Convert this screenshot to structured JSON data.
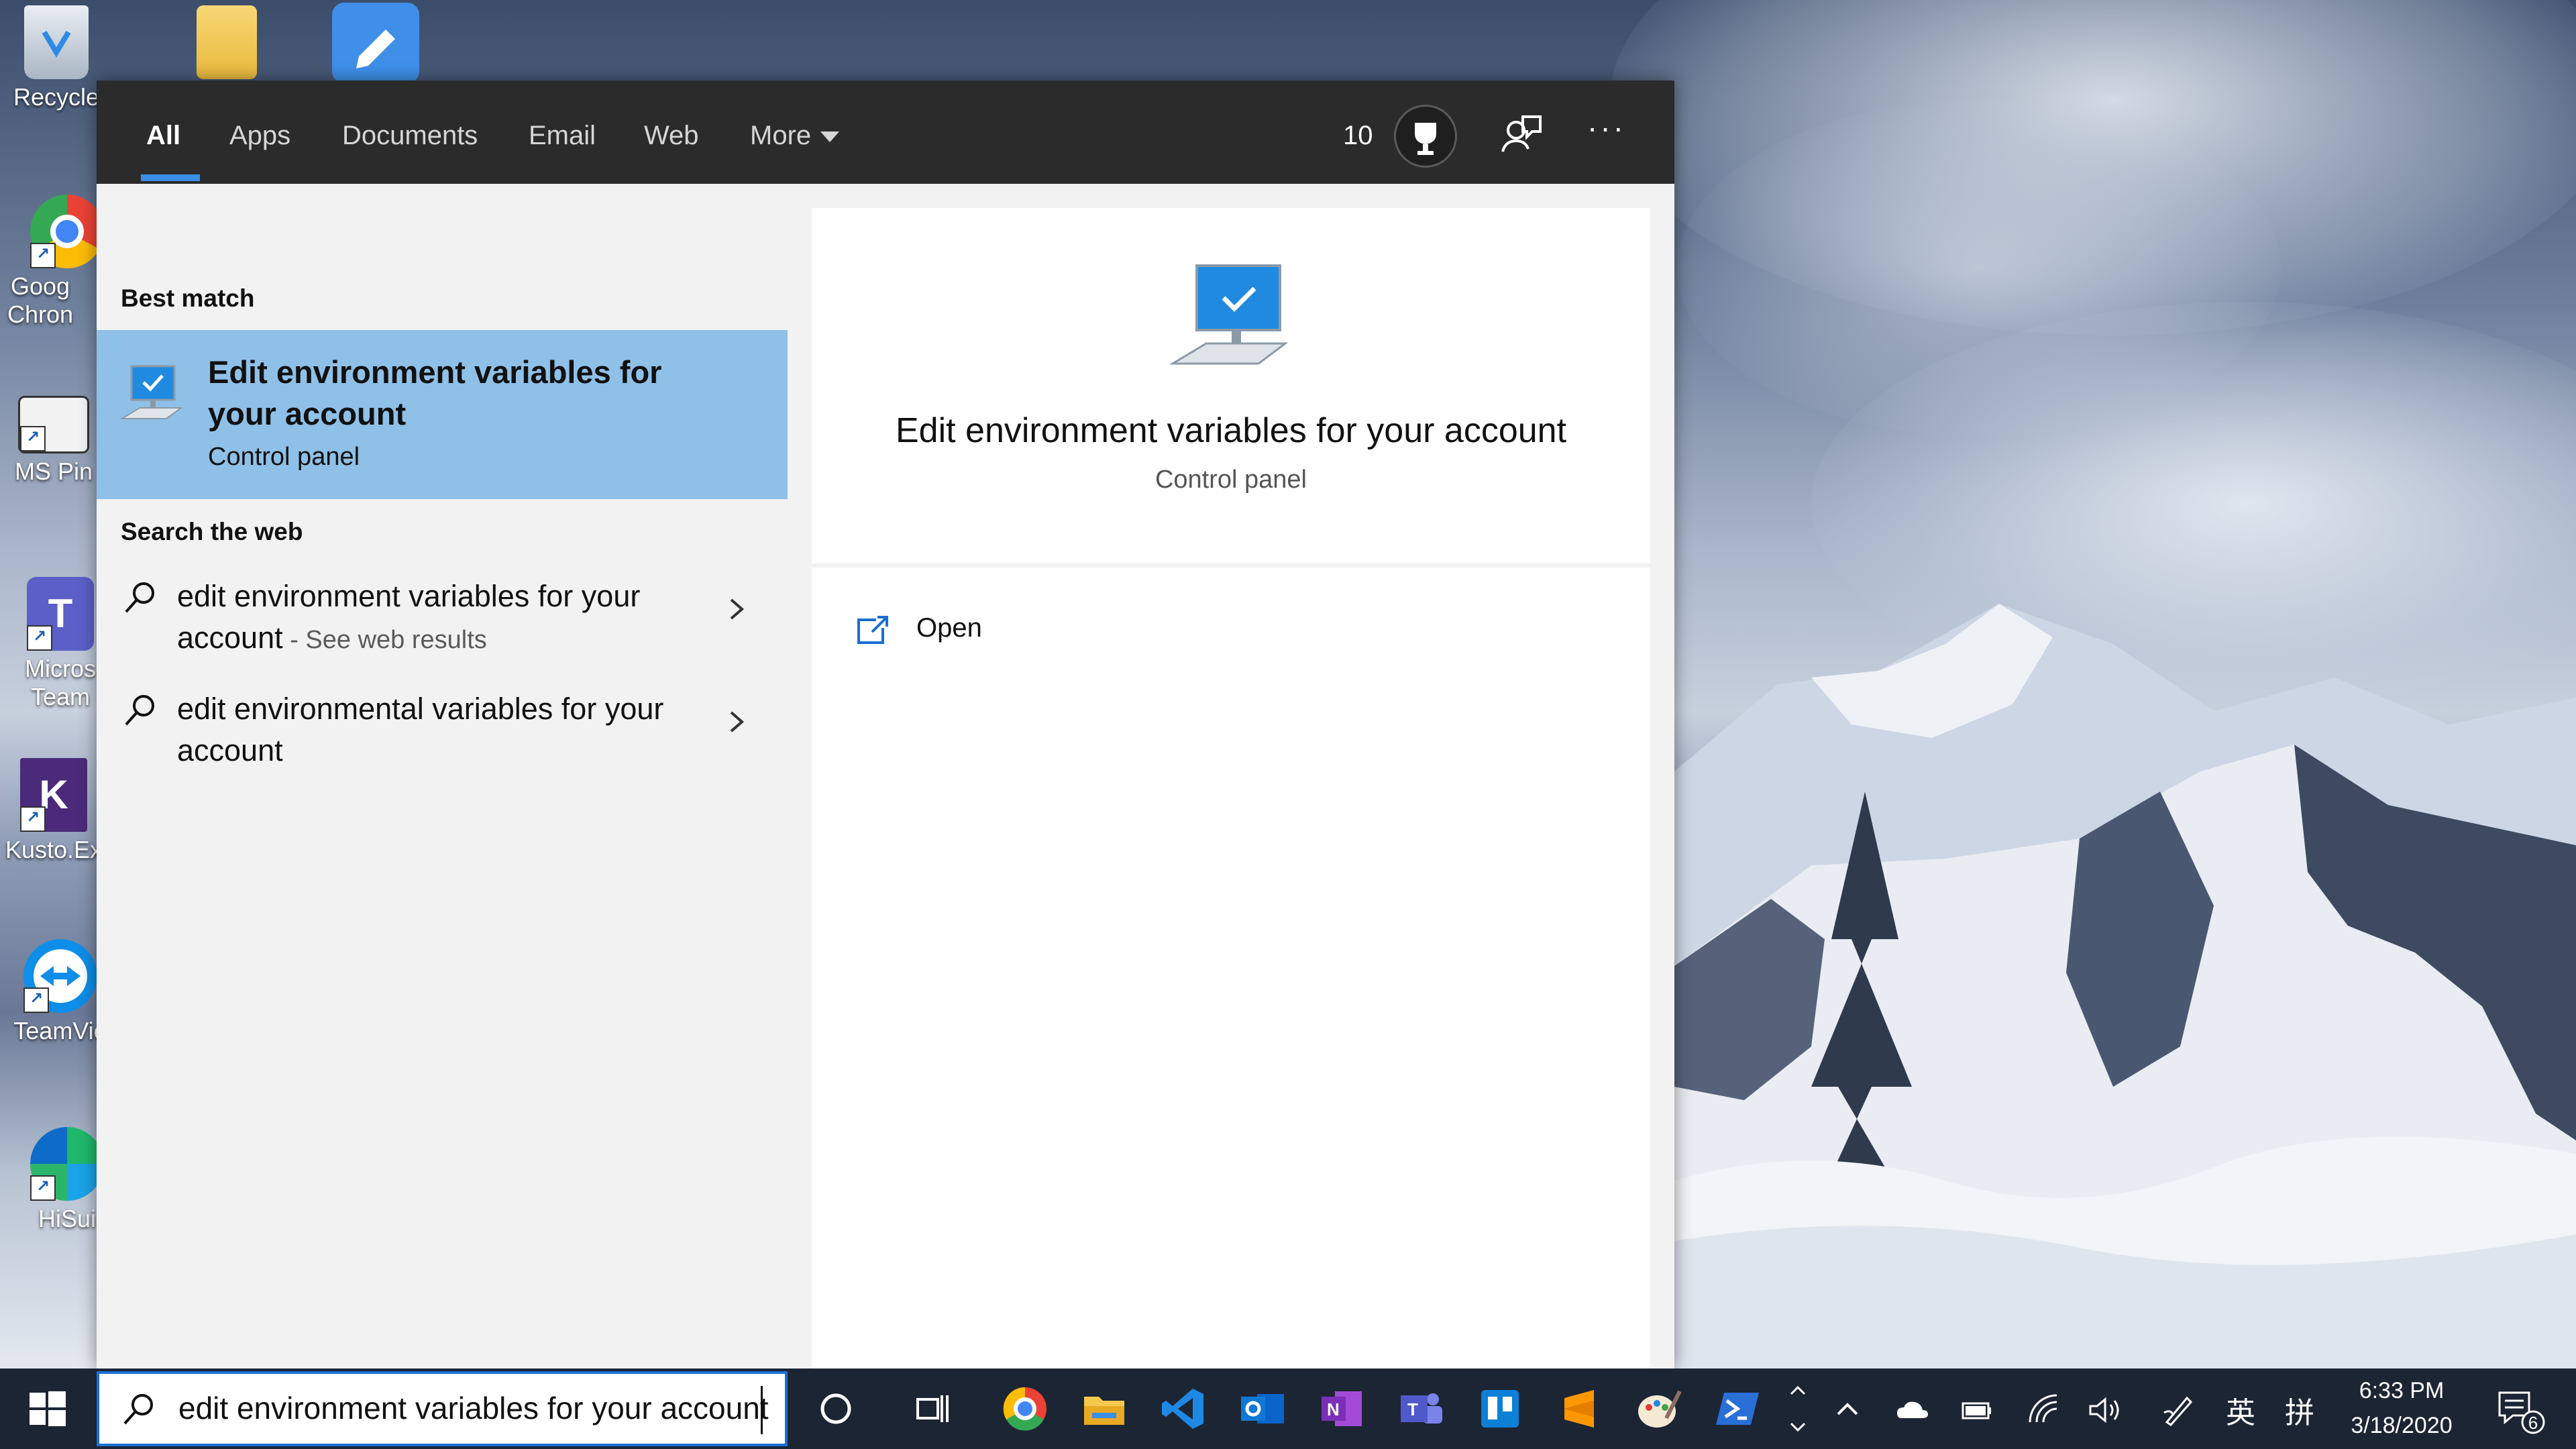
{
  "desktop": {
    "icons": [
      {
        "label": "Recycle"
      },
      {
        "label": ""
      },
      {
        "label": ""
      },
      {
        "label": "Goog\nChron"
      },
      {
        "label": "MS Pin"
      },
      {
        "label": "Micros\nTeam"
      },
      {
        "label": "Kusto.Ex"
      },
      {
        "label": "TeamVie"
      },
      {
        "label": "HiSui"
      }
    ]
  },
  "search_panel": {
    "tabs": [
      {
        "label": "All",
        "active": true
      },
      {
        "label": "Apps"
      },
      {
        "label": "Documents"
      },
      {
        "label": "Email"
      },
      {
        "label": "Web"
      },
      {
        "label": "More"
      }
    ],
    "points": "10",
    "more_menu": "···",
    "best_match": {
      "section_label": "Best match",
      "title": "Edit environment variables for your account",
      "subtitle": "Control panel"
    },
    "search_web": {
      "section_label": "Search the web",
      "items": [
        {
          "text": "edit environment variables for your account",
          "hint": " - See web results"
        },
        {
          "text": "edit environmental variables for your account",
          "hint": ""
        }
      ]
    },
    "preview": {
      "title": "Edit environment variables for your account",
      "subtitle": "Control panel",
      "actions": [
        {
          "label": "Open"
        }
      ]
    }
  },
  "taskbar": {
    "search_value": "edit environment variables for your account",
    "time": "6:33 PM",
    "date": "3/18/2020",
    "ime_1": "英",
    "ime_2": "拼",
    "notification_count": "6",
    "accent": "#1a6fd1"
  }
}
